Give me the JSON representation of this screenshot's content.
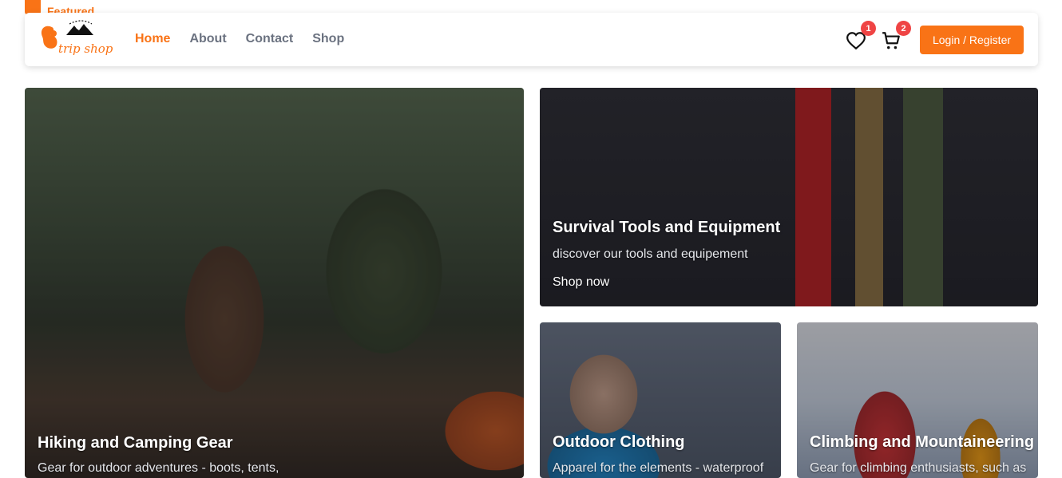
{
  "featured": {
    "label": "Featured"
  },
  "brand": {
    "logo_text": "trip shop"
  },
  "nav": {
    "links": [
      {
        "label": "Home",
        "active": true
      },
      {
        "label": "About"
      },
      {
        "label": "Contact"
      },
      {
        "label": "Shop"
      }
    ]
  },
  "header": {
    "wishlist_count": "1",
    "cart_count": "2",
    "login_label": "Login / Register"
  },
  "colors": {
    "accent": "#f97316",
    "badge": "#ef4444"
  },
  "cards": {
    "hiking": {
      "title": "Hiking and Camping Gear",
      "description": "Gear for outdoor adventures - boots, tents,"
    },
    "tools": {
      "title": "Survival Tools and Equipment",
      "description": "discover our tools and equipement",
      "link": "Shop now"
    },
    "clothing": {
      "title": "Outdoor Clothing",
      "description": "Apparel for the elements - waterproof"
    },
    "climbing": {
      "title": "Climbing and Mountaineering",
      "description": "Gear for climbing enthusiasts, such as"
    }
  }
}
